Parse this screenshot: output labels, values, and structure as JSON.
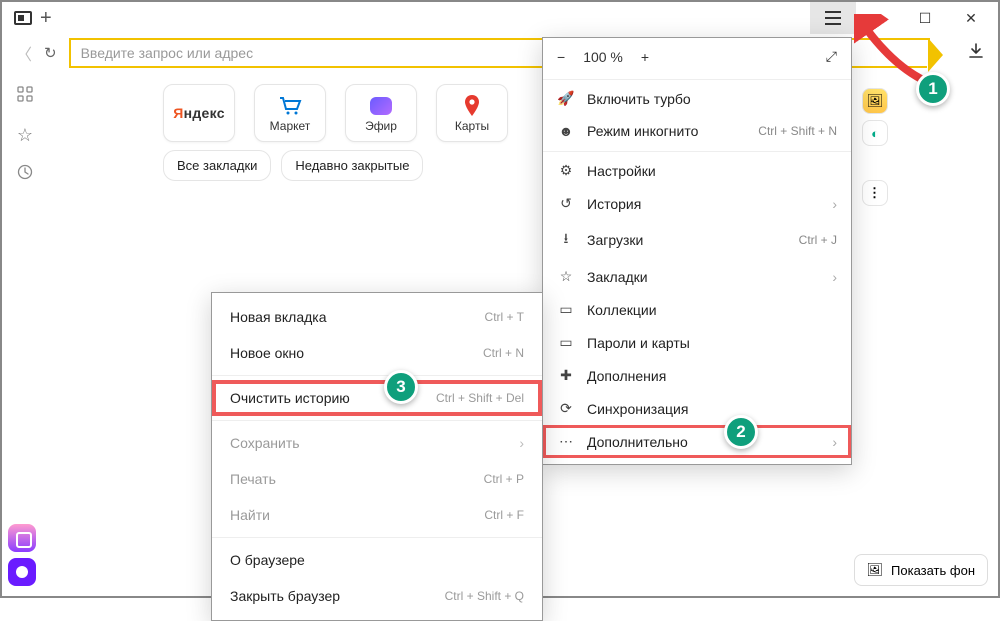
{
  "address_placeholder": "Введите запрос или адрес",
  "zoom": {
    "minus": "−",
    "value": "100 %",
    "plus": "+"
  },
  "tiles": [
    {
      "label_html": "Яндекс"
    },
    {
      "label": "Маркет"
    },
    {
      "label": "Эфир"
    },
    {
      "label": "Карты"
    }
  ],
  "pillbuttons": {
    "all_bookmarks": "Все закладки",
    "recent": "Недавно закрытые"
  },
  "menu": {
    "turbo": "Включить турбо",
    "incognito": "Режим инкогнито",
    "incognito_sc": "Ctrl + Shift + N",
    "settings": "Настройки",
    "history": "История",
    "downloads": "Загрузки",
    "downloads_sc": "Ctrl + J",
    "bookmarks": "Закладки",
    "collections": "Коллекции",
    "passwords": "Пароли и карты",
    "addons": "Дополнения",
    "sync": "Синхронизация",
    "more": "Дополнительно"
  },
  "submenu": {
    "new_tab": "Новая вкладка",
    "new_tab_sc": "Ctrl + T",
    "new_window": "Новое окно",
    "new_window_sc": "Ctrl + N",
    "clear_history": "Очистить историю",
    "clear_history_sc": "Ctrl + Shift + Del",
    "save": "Сохранить",
    "print": "Печать",
    "print_sc": "Ctrl + P",
    "find": "Найти",
    "find_sc": "Ctrl + F",
    "about": "О браузере",
    "close": "Закрыть браузер",
    "close_sc": "Ctrl + Shift + Q"
  },
  "badges": {
    "b1": "1",
    "b2": "2",
    "b3": "3"
  },
  "show_bg": "Показать фон"
}
